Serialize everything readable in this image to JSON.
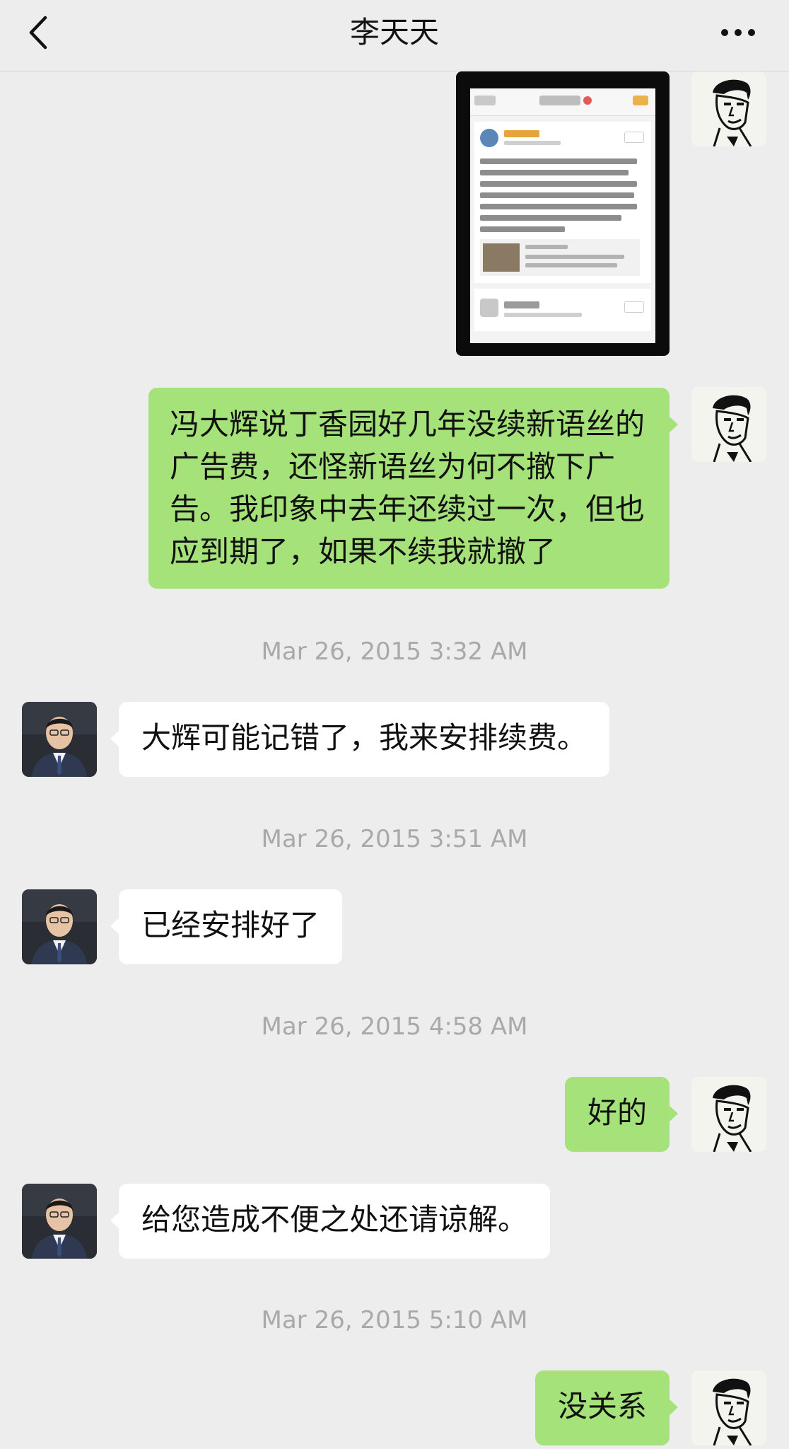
{
  "header": {
    "title": "李天天",
    "back_icon": "chevron-left-icon",
    "more_icon": "more-dots-icon"
  },
  "messages": [
    {
      "type": "image",
      "sender": "me"
    },
    {
      "type": "text",
      "sender": "me",
      "text": "冯大辉说丁香园好几年没续新语丝的广告费，还怪新语丝为何不撤下广告。我印象中去年还续过一次，但也应到期了，如果不续我就撤了"
    },
    {
      "type": "timestamp",
      "text": "Mar 26, 2015 3:32 AM"
    },
    {
      "type": "text",
      "sender": "them",
      "text": "大辉可能记错了，我来安排续费。"
    },
    {
      "type": "timestamp",
      "text": "Mar 26, 2015 3:51 AM"
    },
    {
      "type": "text",
      "sender": "them",
      "text": "已经安排好了"
    },
    {
      "type": "timestamp",
      "text": "Mar 26, 2015 4:58 AM"
    },
    {
      "type": "text",
      "sender": "me",
      "text": "好的"
    },
    {
      "type": "text",
      "sender": "them",
      "text": "给您造成不便之处还请谅解。"
    },
    {
      "type": "timestamp",
      "text": "Mar 26, 2015 5:10 AM"
    },
    {
      "type": "text",
      "sender": "me",
      "text": "没关系"
    }
  ],
  "colors": {
    "background": "#ededed",
    "bubble_me": "#a6e27a",
    "bubble_them": "#ffffff",
    "timestamp": "#a9a9a9"
  }
}
